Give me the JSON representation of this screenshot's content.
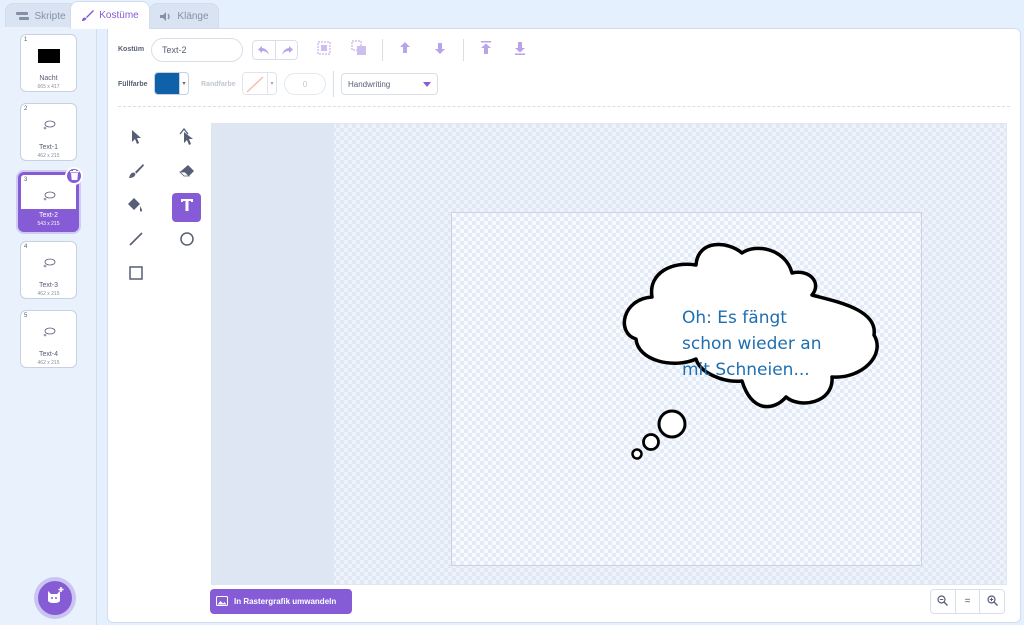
{
  "tabs": [
    {
      "label": "Skripte",
      "icon": "code-icon"
    },
    {
      "label": "Kostüme",
      "icon": "brush-icon"
    },
    {
      "label": "Klänge",
      "icon": "speaker-icon"
    }
  ],
  "costumes": [
    {
      "num": "1",
      "name": "Nacht",
      "size": "665 x 417"
    },
    {
      "num": "2",
      "name": "Text-1",
      "size": "462 x 215"
    },
    {
      "num": "3",
      "name": "Text-2",
      "size": "543 x 215"
    },
    {
      "num": "4",
      "name": "Text-3",
      "size": "462 x 215"
    },
    {
      "num": "5",
      "name": "Text-4",
      "size": "462 x 215"
    }
  ],
  "selected_costume": 3,
  "toolbar": {
    "costume_label": "Kostüm",
    "costume_name": "Text-2",
    "fill_label": "Füllfarbe",
    "outline_label": "Randfarbe",
    "outline_width": "0",
    "font": "Handwriting",
    "fill_color": "#0f62a8"
  },
  "canvas": {
    "text_lines": [
      "Oh: Es fängt",
      "schon wieder an",
      "mit Schneien..."
    ],
    "text_color": "#1f6fb0"
  },
  "convert_button_label": "In Rastergrafik umwandeln",
  "zoom": {
    "out": "−",
    "reset": "=",
    "in": "+"
  },
  "colors": {
    "accent": "#855cd6",
    "panel_bg": "#e5f0ff"
  }
}
